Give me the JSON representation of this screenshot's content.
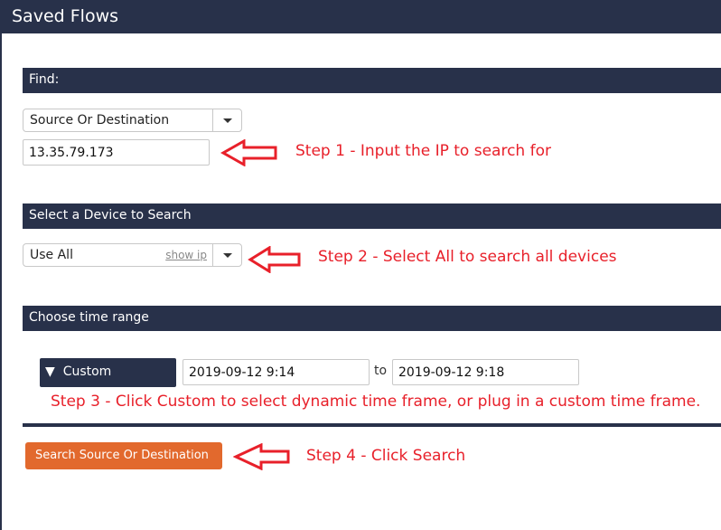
{
  "header": {
    "title": "Saved Flows"
  },
  "find": {
    "label": "Find:",
    "type_select": "Source Or Destination",
    "ip_value": "13.35.79.173"
  },
  "device": {
    "label": "Select a Device to Search",
    "select": "Use All",
    "show_ip": "show ip"
  },
  "time": {
    "label": "Choose time range",
    "range_button": "Custom",
    "range_icon": "triangle-down-icon",
    "from": "2019-09-12 9:14",
    "to_label": "to",
    "to": "2019-09-12 9:18"
  },
  "search_button": "Search Source Or Destination",
  "annotations": {
    "step1": "Step 1 - Input the IP to search for",
    "step2": "Step 2 - Select All to search all devices",
    "step3": "Step 3 - Click Custom to select dynamic time frame, or plug in a custom time frame.",
    "step4": "Step 4 - Click Search"
  },
  "colors": {
    "header": "#28314a",
    "accent": "#e2692d",
    "annotation": "#e8202a"
  }
}
